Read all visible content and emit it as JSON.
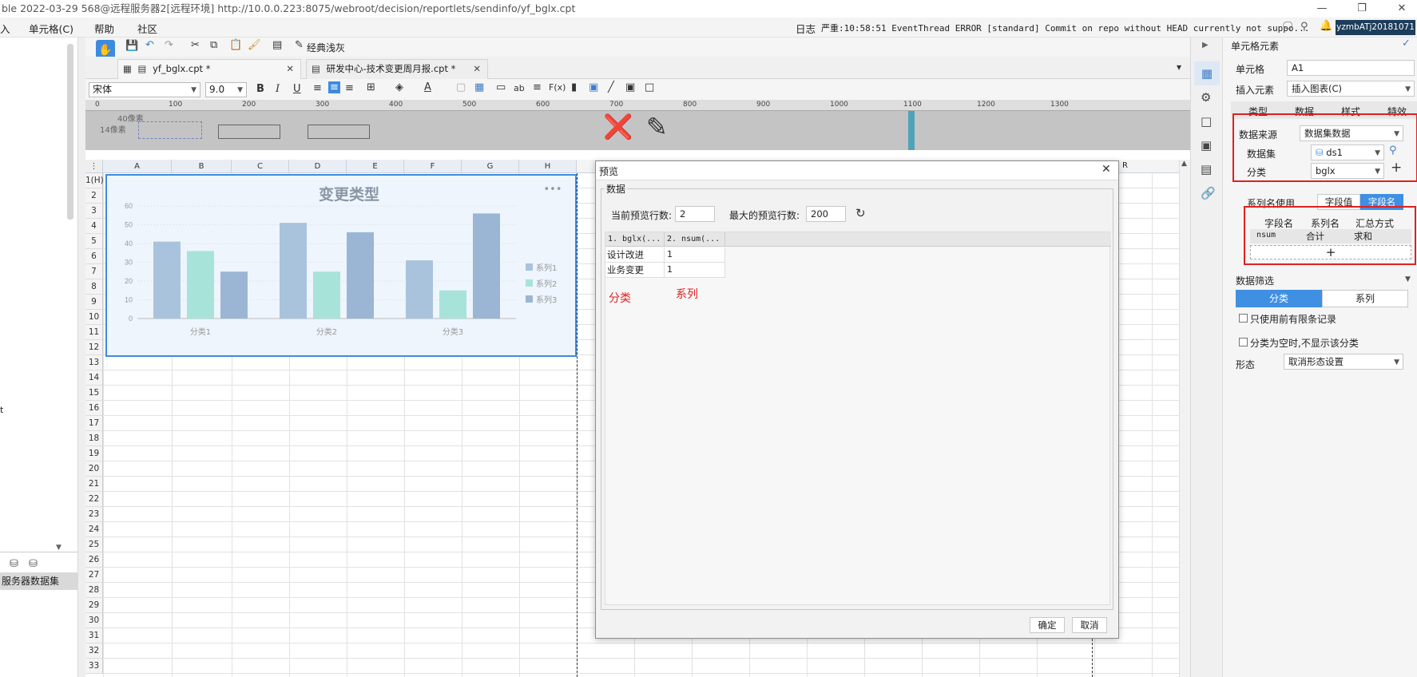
{
  "window": {
    "title": "ble 2022-03-29 568@远程服务器2[远程环境]    http://10.0.0.223:8075/webroot/decision/reportlets/sendinfo/yf_bglx.cpt"
  },
  "menubar": {
    "items": [
      "入",
      "单元格(C)",
      "帮助",
      "社区"
    ],
    "log_label": "日志",
    "log_text": "严重:10:58:51 EventThread ERROR [standard] Commit on repo without HEAD currently not suppo...",
    "user": "yzmbATj20181071"
  },
  "left_panel": {
    "fragments": [
      "t"
    ],
    "dataset_label": "服务器数据集"
  },
  "toolbar": {
    "classic_label": "经典浅灰"
  },
  "tabs": [
    {
      "label": "yf_bglx.cpt *"
    },
    {
      "label": "研发中心-技术变更周月报.cpt *"
    }
  ],
  "format_bar": {
    "font": "宋体",
    "size": "9.0"
  },
  "ruler": {
    "ticks": [
      "0",
      "100",
      "200",
      "300",
      "400",
      "500",
      "600",
      "700",
      "800",
      "900",
      "1000",
      "1100",
      "1200",
      "1300"
    ],
    "label_40": "40像素",
    "label_14": "14像素"
  },
  "sheet": {
    "columns": [
      "A",
      "B",
      "C",
      "D",
      "E",
      "F",
      "G",
      "H"
    ],
    "extra_col": "R",
    "rows": [
      "1(H)",
      "2",
      "3",
      "4",
      "5",
      "6",
      "7",
      "8",
      "9",
      "10",
      "11",
      "12",
      "13",
      "14",
      "15",
      "16",
      "17",
      "18",
      "19",
      "20",
      "21",
      "22",
      "23",
      "24",
      "25",
      "26",
      "27",
      "28",
      "29",
      "30",
      "31",
      "32",
      "33"
    ]
  },
  "chart_data": {
    "type": "bar",
    "title": "变更类型",
    "categories": [
      "分类1",
      "分类2",
      "分类3"
    ],
    "series": [
      {
        "name": "系列1",
        "values": [
          41,
          51,
          31
        ]
      },
      {
        "name": "系列2",
        "values": [
          36,
          25,
          15
        ]
      },
      {
        "name": "系列3",
        "values": [
          25,
          46,
          56
        ]
      }
    ],
    "ylim": [
      0,
      60
    ],
    "yticks": [
      "0",
      "10",
      "20",
      "30",
      "40",
      "50",
      "60"
    ],
    "colors": [
      "#a9c3dc",
      "#a8e3da",
      "#9bb6d4"
    ],
    "legend": "right"
  },
  "dialog": {
    "title": "预览",
    "group_label": "数据",
    "current_rows_label": "当前预览行数:",
    "current_rows_value": "2",
    "max_rows_label": "最大的预览行数:",
    "max_rows_value": "200",
    "headers": [
      "1. bglx(...",
      "2. nsum(..."
    ],
    "rows": [
      [
        "设计改进",
        "1"
      ],
      [
        "业务变更",
        "1"
      ]
    ],
    "annotation_category": "分类",
    "annotation_series": "系列",
    "ok": "确定",
    "cancel": "取消"
  },
  "right_panel": {
    "title": "单元格元素",
    "cell_label": "单元格",
    "cell_value": "A1",
    "insert_label": "插入元素",
    "insert_value": "插入图表(C)",
    "tabs": [
      "类型",
      "数据",
      "样式",
      "特效"
    ],
    "datasource_label": "数据来源",
    "datasource_value": "数据集数据",
    "dataset_label": "数据集",
    "dataset_value": "ds1",
    "category_label": "分类",
    "category_value": "bglx",
    "series_name_label": "系列名使用",
    "series_name_opts": [
      "字段值",
      "字段名"
    ],
    "field_headers": [
      "字段名",
      "系列名",
      "汇总方式"
    ],
    "field_row": [
      "nsum",
      "合计",
      "求和"
    ],
    "filter_label": "数据筛选",
    "filter_tabs": [
      "分类",
      "系列"
    ],
    "check1": "只使用前有限条记录",
    "check2": "分类为空时,不显示该分类",
    "form_label": "形态",
    "form_value": "取消形态设置"
  }
}
